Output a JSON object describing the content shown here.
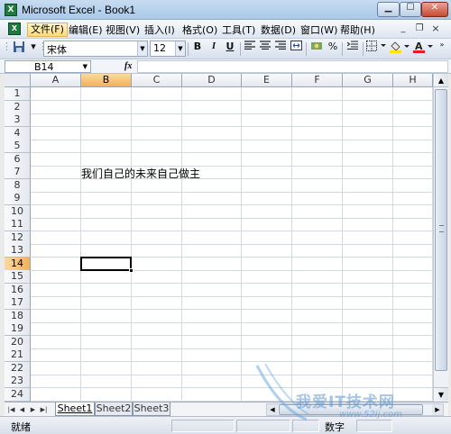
{
  "window": {
    "title": "Microsoft Excel - Book1"
  },
  "menu": [
    {
      "label": "文件(F)",
      "active": true
    },
    {
      "label": "编辑(E)"
    },
    {
      "label": "视图(V)"
    },
    {
      "label": "插入(I)"
    },
    {
      "label": "格式(O)"
    },
    {
      "label": "工具(T)"
    },
    {
      "label": "数据(D)"
    },
    {
      "label": "窗口(W)"
    },
    {
      "label": "帮助(H)"
    }
  ],
  "toolbar": {
    "font_name": "宋体",
    "font_size": "12",
    "bold": "B",
    "italic": "I",
    "underline": "U",
    "percent": "%"
  },
  "formula_bar": {
    "name_box": "B14",
    "fx": "fx",
    "formula": ""
  },
  "grid": {
    "columns": [
      "A",
      "B",
      "C",
      "D",
      "E",
      "F",
      "G",
      "H"
    ],
    "selected_column": "B",
    "rows": [
      "1",
      "2",
      "3",
      "4",
      "5",
      "6",
      "7",
      "8",
      "9",
      "10",
      "11",
      "12",
      "13",
      "14",
      "15",
      "16",
      "17",
      "18",
      "19",
      "20",
      "21",
      "22",
      "23",
      "24"
    ],
    "selected_row": "14",
    "cells": {
      "B7": "我们自己的未来自己做主"
    }
  },
  "sheet_tabs": [
    {
      "label": "Sheet1",
      "active": true
    },
    {
      "label": "Sheet2"
    },
    {
      "label": "Sheet3"
    }
  ],
  "status": {
    "ready": "就绪",
    "num": "数字"
  },
  "watermark": {
    "text": "我爱IT技术网",
    "url": "www.52ij.com"
  },
  "colors": {
    "selection": "#f3b05a",
    "title_gradient": "#a9c8e8",
    "watermark": "#5a96d2"
  }
}
